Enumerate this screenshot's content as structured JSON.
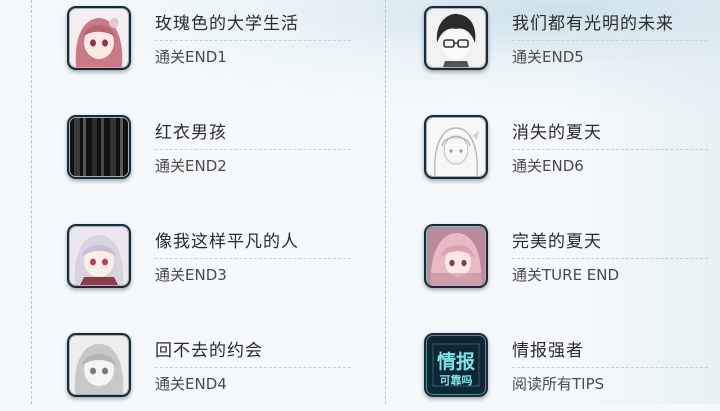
{
  "left_column": [
    {
      "title": "玫瑰色的大学生活",
      "status": "通关END1",
      "icon": "pink-haired-girl-portrait"
    },
    {
      "title": "红衣男孩",
      "status": "通关END2",
      "icon": "dark-curtain-image"
    },
    {
      "title": "像我这样平凡的人",
      "status": "通关END3",
      "icon": "white-haired-girl-portrait"
    },
    {
      "title": "回不去的约会",
      "status": "通关END4",
      "icon": "grayscale-girl-portrait"
    }
  ],
  "right_column": [
    {
      "title": "我们都有光明的未来",
      "status": "通关END5",
      "icon": "glasses-boy-portrait"
    },
    {
      "title": "消失的夏天",
      "status": "通关END6",
      "icon": "sketch-girl-portrait"
    },
    {
      "title": "完美的夏天",
      "status": "通关TURE END",
      "icon": "pink-girl-portrait"
    },
    {
      "title": "情报强者",
      "status": "阅读所有TIPS",
      "icon": "info-badge",
      "badge_text": [
        "情报",
        "可靠吗"
      ]
    }
  ],
  "colors": {
    "background": "#f6f9fb",
    "title": "#2b2b2b",
    "status": "#4a4a4a",
    "badge": "#0e2733",
    "badge_text": "#7fe3e6"
  }
}
